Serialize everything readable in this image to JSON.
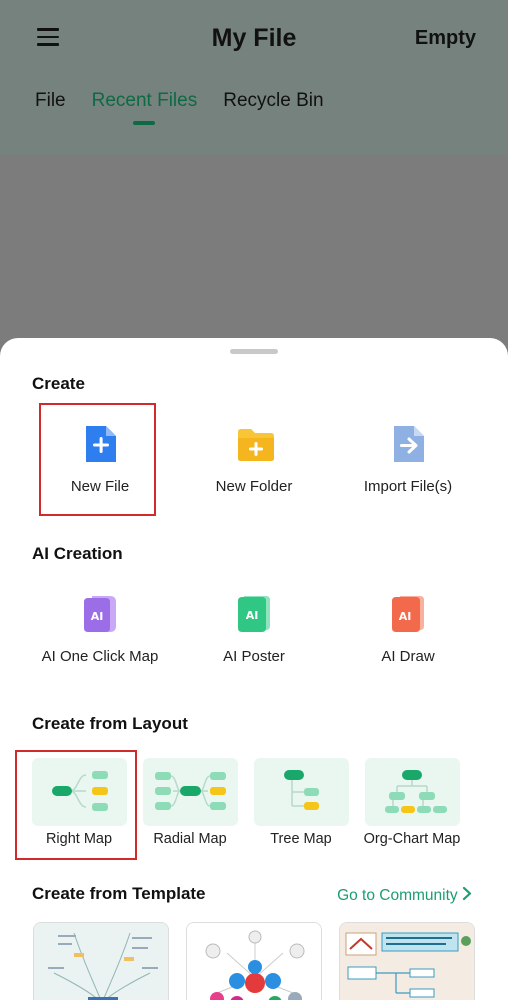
{
  "header": {
    "title": "My File",
    "action": "Empty",
    "tabs": [
      {
        "label": "File"
      },
      {
        "label": "Recent Files"
      },
      {
        "label": "Recycle Bin"
      }
    ]
  },
  "sheet": {
    "create": {
      "title": "Create",
      "items": [
        {
          "label": "New File",
          "icon": "new-file-icon",
          "color": "#2f7ef0"
        },
        {
          "label": "New Folder",
          "icon": "new-folder-icon",
          "color": "#f5b51e"
        },
        {
          "label": "Import File(s)",
          "icon": "import-file-icon",
          "color": "#7fa7e0"
        }
      ]
    },
    "ai_creation": {
      "title": "AI Creation",
      "items": [
        {
          "label": "AI One Click Map",
          "icon": "ai-one-click-map-icon",
          "color": "#9b6ee8"
        },
        {
          "label": "AI Poster",
          "icon": "ai-poster-icon",
          "color": "#2fc783"
        },
        {
          "label": "AI Draw",
          "icon": "ai-draw-icon",
          "color": "#f26a4b"
        }
      ]
    },
    "layouts": {
      "title": "Create from Layout",
      "items": [
        {
          "label": "Right Map"
        },
        {
          "label": "Radial Map"
        },
        {
          "label": "Tree Map"
        },
        {
          "label": "Org-Chart Map"
        }
      ]
    },
    "templates": {
      "title": "Create from Template",
      "community_link": "Go to Community"
    }
  },
  "colors": {
    "accent": "#1b9e73",
    "highlight": "#d12a2a"
  }
}
